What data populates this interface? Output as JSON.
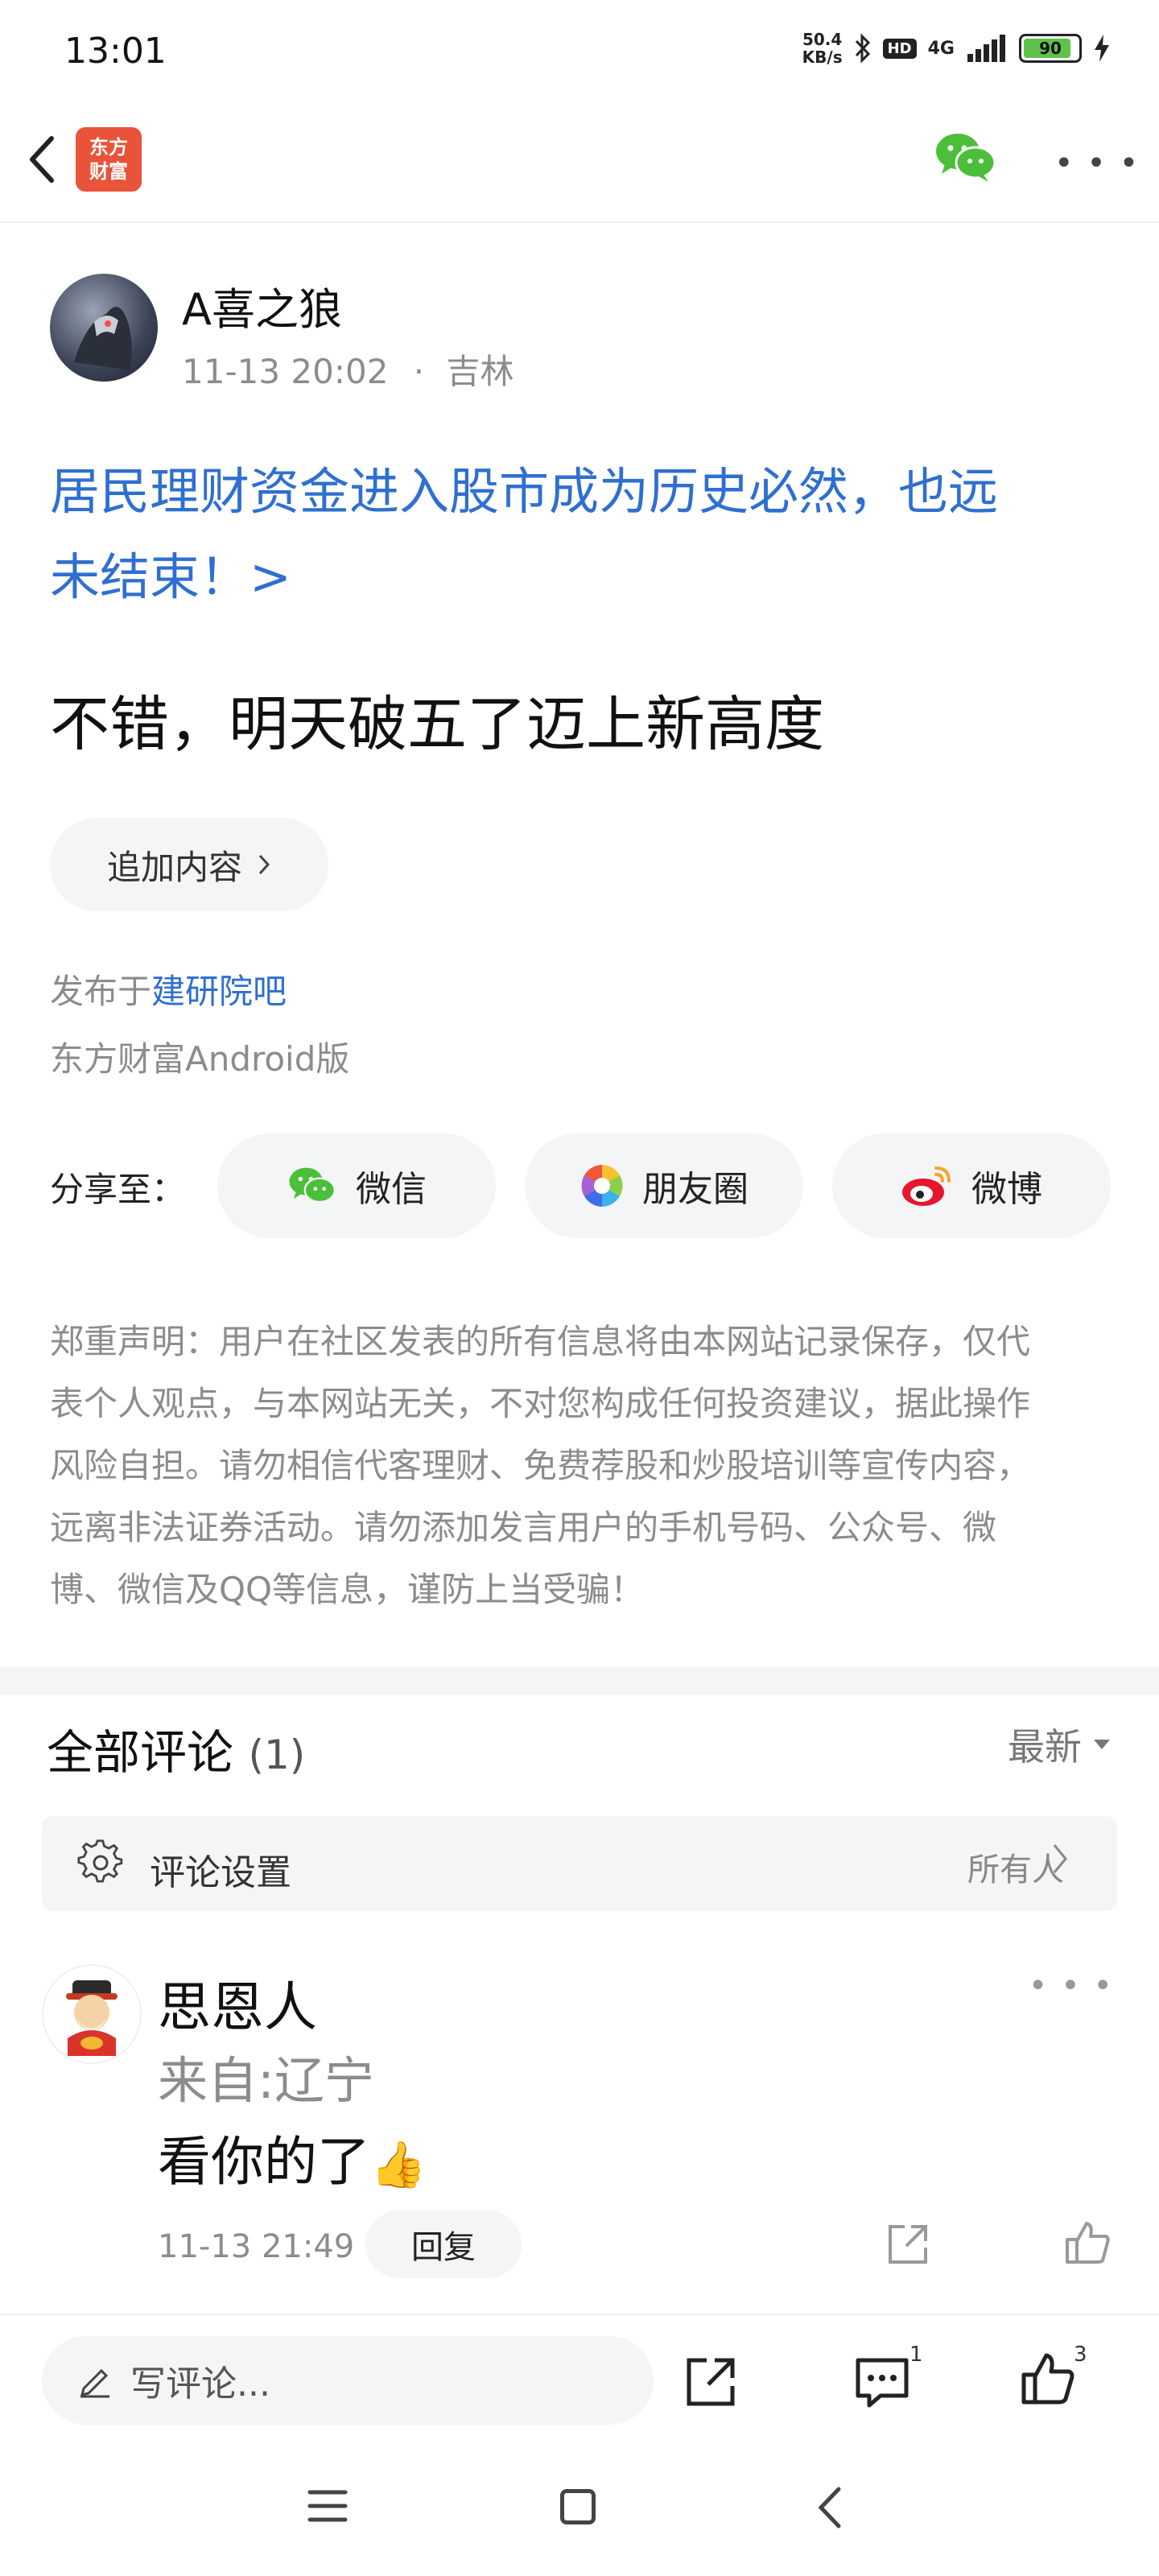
{
  "status_bar": {
    "time": "13:01",
    "net_speed_value": "50.4",
    "net_speed_unit": "KB/s",
    "hd_badge": "HD",
    "signal_label": "4G",
    "battery_level": "90"
  },
  "header": {
    "logo_line1": "东方",
    "logo_line2": "财富",
    "icons": [
      "back-arrow-icon",
      "wechat-icon",
      "more-icon"
    ]
  },
  "post": {
    "author": "A喜之狼",
    "time": "11-13 20:02",
    "separator": "·",
    "location": "吉林",
    "title_line1": "居民理财资金进入股市成为历史必然，也远",
    "title_line2": "未结束！>",
    "body": "不错，明天破五了迈上新高度",
    "append_label": "追加内容",
    "published_prefix": "发布于",
    "forum": "建研院吧",
    "client": "东方财富Android版"
  },
  "share": {
    "label": "分享至：",
    "targets": [
      {
        "label": "微信",
        "icon": "wechat-icon"
      },
      {
        "label": "朋友圈",
        "icon": "moments-icon"
      },
      {
        "label": "微博",
        "icon": "weibo-icon"
      }
    ]
  },
  "disclaimer": {
    "line1": "郑重声明：用户在社区发表的所有信息将由本网站记录保存，仅代",
    "line2": "表个人观点，与本网站无关，不对您构成任何投资建议，据此操作",
    "line3": "风险自担。请勿相信代客理财、免费荐股和炒股培训等宣传内容，",
    "line4": "远离非法证券活动。请勿添加发言用户的手机号码、公众号、微",
    "line5": "博、微信及QQ等信息，谨防上当受骗！"
  },
  "comments": {
    "title": "全部评论",
    "count": "(1)",
    "sort_label": "最新",
    "settings_label": "评论设置",
    "settings_value": "所有人",
    "items": [
      {
        "name": "思恩人",
        "from": "来自:辽宁",
        "text": "看你的了",
        "emoji": "👍",
        "time": "11-13 21:49",
        "reply_label": "回复"
      }
    ]
  },
  "bottom_bar": {
    "write_placeholder": "写评论...",
    "comment_count": "1",
    "like_count": "3"
  },
  "colors": {
    "link_blue": "#2f6fd1",
    "brand_orange": "#e9533a",
    "wechat_green": "#4cbf3a",
    "weibo_red": "#e6162d",
    "muted_gray": "#8c8c8c",
    "chip_bg": "#f4f5f7"
  }
}
